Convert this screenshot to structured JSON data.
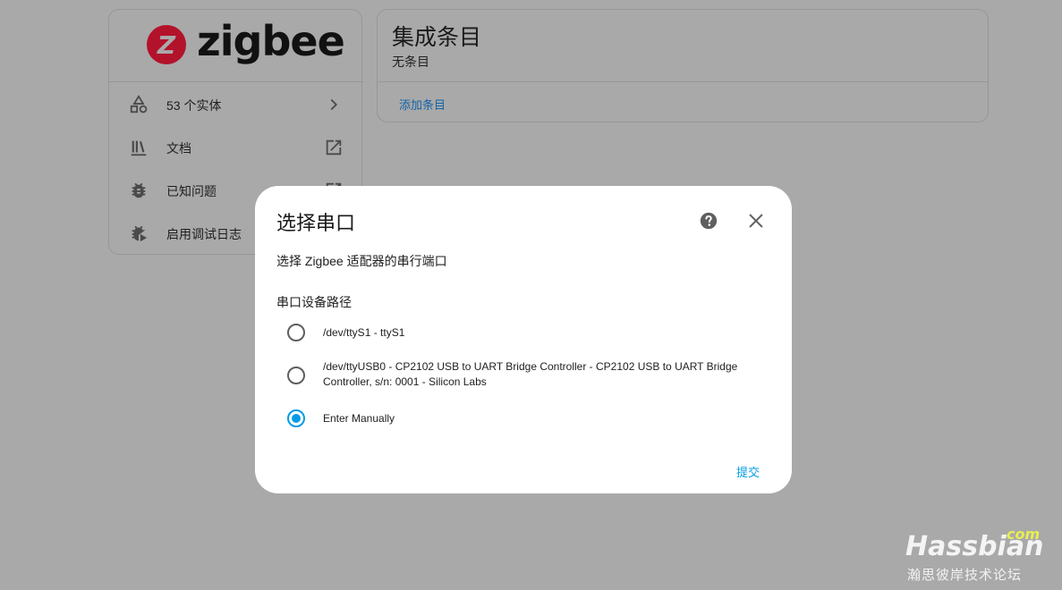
{
  "brand": {
    "logo_mark": "Z",
    "logo_text": "zigbee"
  },
  "integration_menu": {
    "items": [
      {
        "label": "53 个实体",
        "icon": "shapes-icon",
        "trail": "chevron-right-icon"
      },
      {
        "label": "文档",
        "icon": "library-icon",
        "trail": "open-in-new-icon"
      },
      {
        "label": "已知问题",
        "icon": "bug-icon",
        "trail": "open-in-new-icon"
      },
      {
        "label": "启用调试日志",
        "icon": "bug-play-icon",
        "trail": ""
      }
    ]
  },
  "entries": {
    "title": "集成条目",
    "subtitle": "无条目",
    "add_label": "添加条目"
  },
  "dialog": {
    "title": "选择串口",
    "description": "选择 Zigbee 适配器的串行端口",
    "field_label": "串口设备路径",
    "options": [
      {
        "label": "/dev/ttyS1 - ttyS1",
        "checked": false
      },
      {
        "label": "/dev/ttyUSB0 - CP2102 USB to UART Bridge Controller - CP2102 USB to UART Bridge Controller, s/n: 0001 - Silicon Labs",
        "checked": false
      },
      {
        "label": "Enter Manually",
        "checked": true
      }
    ],
    "submit_label": "提交",
    "accent_color": "#039be5"
  },
  "watermark": {
    "name": "Hassbian",
    "suffix": "com",
    "subtitle": "瀚思彼岸技术论坛"
  }
}
